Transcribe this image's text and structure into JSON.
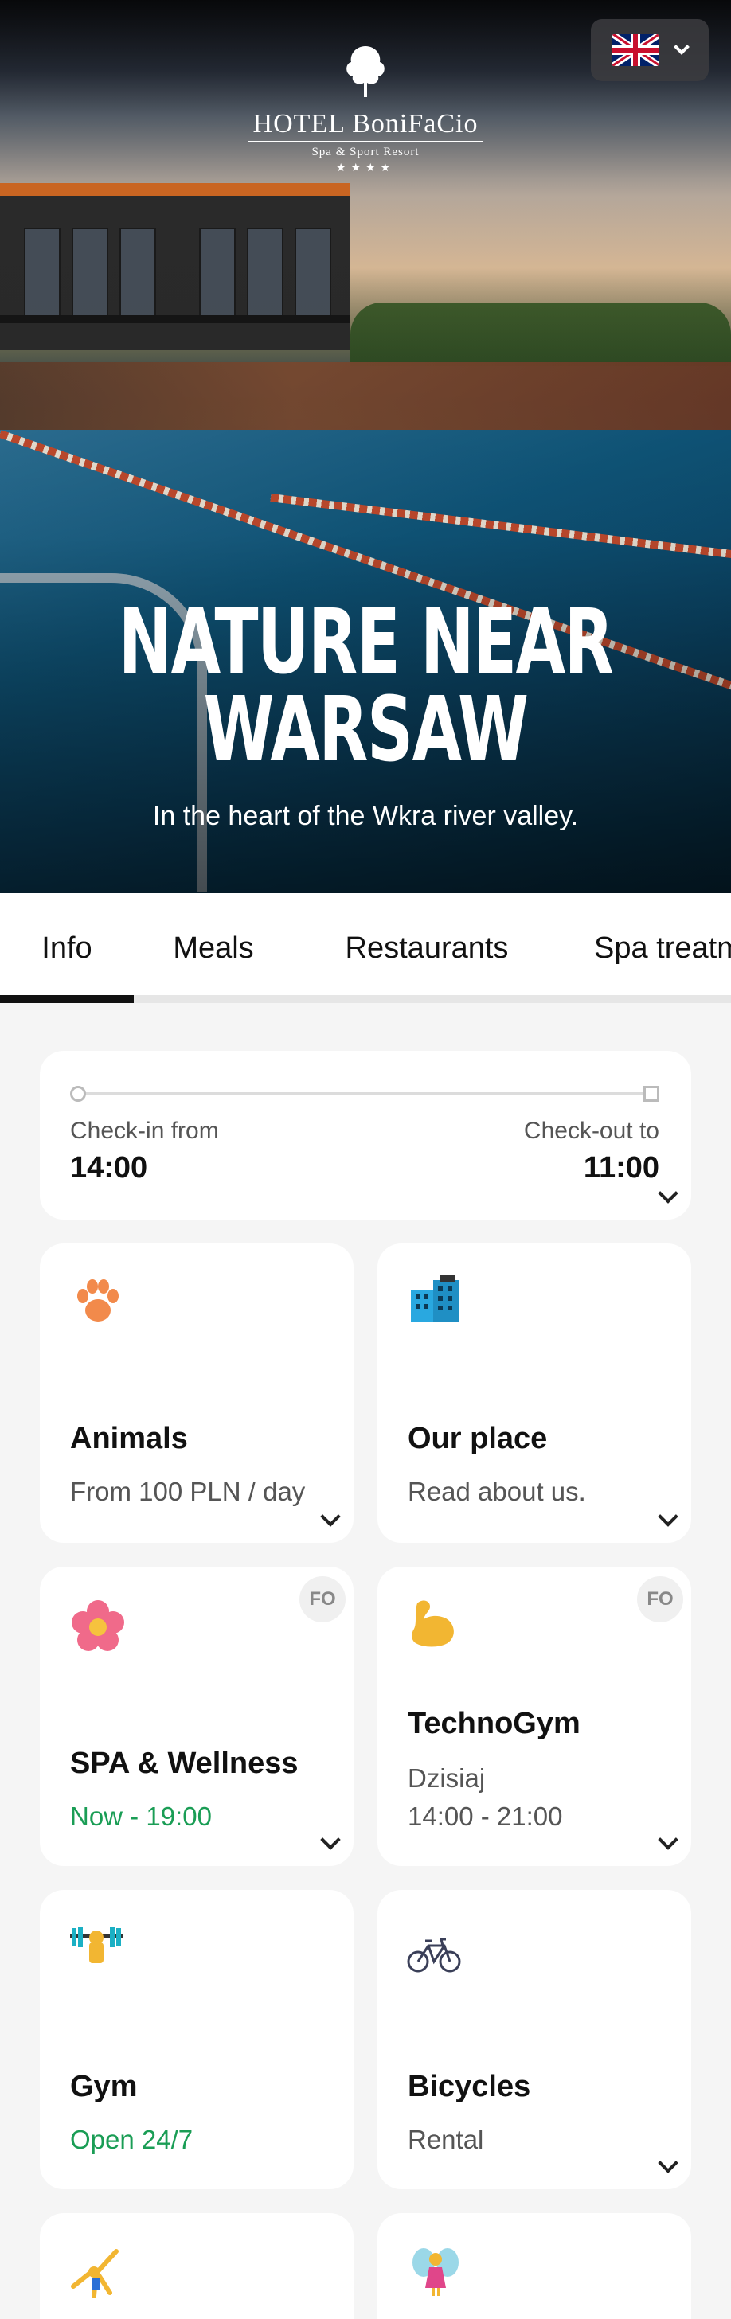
{
  "language": {
    "current": "EN",
    "flag": "uk-flag-icon"
  },
  "logo": {
    "name": "HOTEL BoniFaCio",
    "subtitle": "Spa & Sport Resort",
    "stars": "★★★★"
  },
  "hero": {
    "title_line1": "NATURE NEAR",
    "title_line2": "WARSAW",
    "subtitle": "In the heart of the Wkra river valley."
  },
  "tabs": [
    {
      "label": "Info",
      "active": true
    },
    {
      "label": "Meals",
      "active": false
    },
    {
      "label": "Restaurants",
      "active": false
    },
    {
      "label": "Spa treatments",
      "active": false
    }
  ],
  "checkin": {
    "checkin_label": "Check-in from",
    "checkin_time": "14:00",
    "checkout_label": "Check-out to",
    "checkout_time": "11:00"
  },
  "cards": [
    {
      "icon": "paw-icon",
      "title": "Animals",
      "text": "From 100 PLN / day",
      "badge": ""
    },
    {
      "icon": "buildings-icon",
      "title": "Our place",
      "text": "Read about us.",
      "badge": ""
    },
    {
      "icon": "flower-icon",
      "title": "SPA & Wellness",
      "text": "Now - 19:00",
      "badge": "FO"
    },
    {
      "icon": "flexed-biceps-icon",
      "title": "TechnoGym",
      "text_line1": "Dzisiaj",
      "text_line2": "14:00 - 21:00",
      "badge": "FO"
    },
    {
      "icon": "weightlifter-icon",
      "title": "Gym",
      "text": "Open 24/7",
      "badge": ""
    },
    {
      "icon": "bicycle-icon",
      "title": "Bicycles",
      "text": "Rental",
      "badge": ""
    },
    {
      "icon": "cartwheel-icon",
      "title": "",
      "text": "",
      "badge": ""
    },
    {
      "icon": "fairy-icon",
      "title": "",
      "text": "",
      "badge": ""
    }
  ],
  "colors": {
    "accent_green": "#1a9d55",
    "tab_active": "#111111",
    "card_bg": "#ffffff",
    "page_bg": "#f5f5f5",
    "hero_trim": "#c96522"
  }
}
